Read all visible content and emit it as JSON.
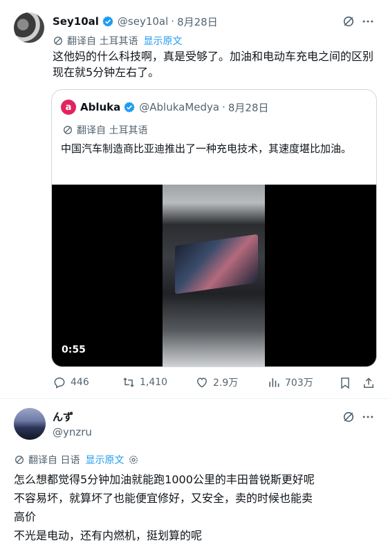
{
  "tweet": {
    "author_name": "Sey10al",
    "handle": "@sey10al",
    "dot": "·",
    "date": "8月28日",
    "translated_from": "翻译自 土耳其语",
    "show_original": "显示原文",
    "text": "这他妈的什么科技啊，真是受够了。加油和电动车充电之间的区别现在就5分钟左右了。"
  },
  "quote": {
    "logo_text": "a",
    "author_name": "Abluka",
    "handle": "@AblukaMedya",
    "dot": "·",
    "date": "8月28日",
    "translated_from": "翻译自 土耳其语",
    "text": "中国汽车制造商比亚迪推出了一种充电技术，其速度堪比加油。",
    "video_duration": "0:55"
  },
  "stats": {
    "replies": "446",
    "retweets": "1,410",
    "likes": "2.9万",
    "views": "703万"
  },
  "reply": {
    "author_name": "んず",
    "handle": "@ynzru",
    "translated_from": "翻译自 日语",
    "show_original": "显示原文",
    "lines": [
      "怎么想都觉得5分钟加油就能跑1000公里的丰田普锐斯更好呢",
      "不容易坏，就算坏了也能便宜修好，又安全，卖的时候也能卖",
      "高价",
      "不光是电动，还有内燃机，挺划算的呢"
    ]
  },
  "colors": {
    "verified": "#1d9bf0",
    "abluka_red": "#e0245e",
    "muted": "#536471",
    "link": "#1d9bf0"
  },
  "icons": [
    "grok-icon",
    "more-icon",
    "translate-icon",
    "reply-icon",
    "retweet-icon",
    "like-icon",
    "views-icon",
    "bookmark-icon",
    "share-icon",
    "verified-badge-icon",
    "settings-gear-icon"
  ]
}
